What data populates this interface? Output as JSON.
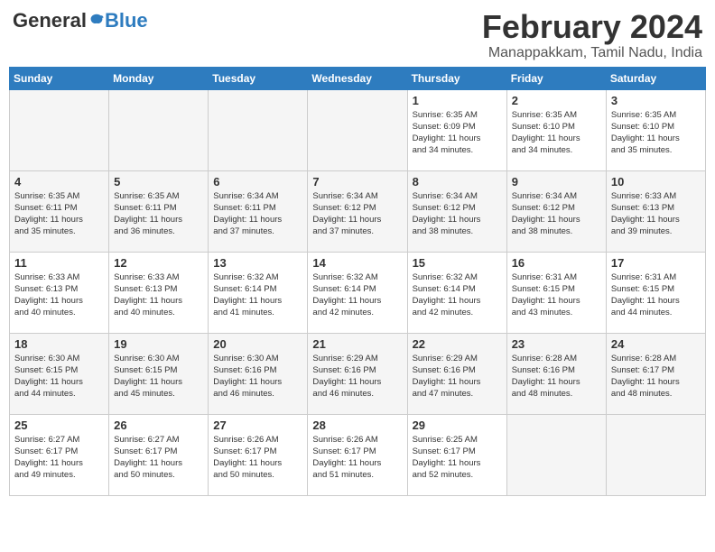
{
  "header": {
    "logo_general": "General",
    "logo_blue": "Blue",
    "title": "February 2024",
    "subtitle": "Manappakkam, Tamil Nadu, India"
  },
  "days_of_week": [
    "Sunday",
    "Monday",
    "Tuesday",
    "Wednesday",
    "Thursday",
    "Friday",
    "Saturday"
  ],
  "weeks": [
    [
      {
        "day": "",
        "info": ""
      },
      {
        "day": "",
        "info": ""
      },
      {
        "day": "",
        "info": ""
      },
      {
        "day": "",
        "info": ""
      },
      {
        "day": "1",
        "info": "Sunrise: 6:35 AM\nSunset: 6:09 PM\nDaylight: 11 hours\nand 34 minutes."
      },
      {
        "day": "2",
        "info": "Sunrise: 6:35 AM\nSunset: 6:10 PM\nDaylight: 11 hours\nand 34 minutes."
      },
      {
        "day": "3",
        "info": "Sunrise: 6:35 AM\nSunset: 6:10 PM\nDaylight: 11 hours\nand 35 minutes."
      }
    ],
    [
      {
        "day": "4",
        "info": "Sunrise: 6:35 AM\nSunset: 6:11 PM\nDaylight: 11 hours\nand 35 minutes."
      },
      {
        "day": "5",
        "info": "Sunrise: 6:35 AM\nSunset: 6:11 PM\nDaylight: 11 hours\nand 36 minutes."
      },
      {
        "day": "6",
        "info": "Sunrise: 6:34 AM\nSunset: 6:11 PM\nDaylight: 11 hours\nand 37 minutes."
      },
      {
        "day": "7",
        "info": "Sunrise: 6:34 AM\nSunset: 6:12 PM\nDaylight: 11 hours\nand 37 minutes."
      },
      {
        "day": "8",
        "info": "Sunrise: 6:34 AM\nSunset: 6:12 PM\nDaylight: 11 hours\nand 38 minutes."
      },
      {
        "day": "9",
        "info": "Sunrise: 6:34 AM\nSunset: 6:12 PM\nDaylight: 11 hours\nand 38 minutes."
      },
      {
        "day": "10",
        "info": "Sunrise: 6:33 AM\nSunset: 6:13 PM\nDaylight: 11 hours\nand 39 minutes."
      }
    ],
    [
      {
        "day": "11",
        "info": "Sunrise: 6:33 AM\nSunset: 6:13 PM\nDaylight: 11 hours\nand 40 minutes."
      },
      {
        "day": "12",
        "info": "Sunrise: 6:33 AM\nSunset: 6:13 PM\nDaylight: 11 hours\nand 40 minutes."
      },
      {
        "day": "13",
        "info": "Sunrise: 6:32 AM\nSunset: 6:14 PM\nDaylight: 11 hours\nand 41 minutes."
      },
      {
        "day": "14",
        "info": "Sunrise: 6:32 AM\nSunset: 6:14 PM\nDaylight: 11 hours\nand 42 minutes."
      },
      {
        "day": "15",
        "info": "Sunrise: 6:32 AM\nSunset: 6:14 PM\nDaylight: 11 hours\nand 42 minutes."
      },
      {
        "day": "16",
        "info": "Sunrise: 6:31 AM\nSunset: 6:15 PM\nDaylight: 11 hours\nand 43 minutes."
      },
      {
        "day": "17",
        "info": "Sunrise: 6:31 AM\nSunset: 6:15 PM\nDaylight: 11 hours\nand 44 minutes."
      }
    ],
    [
      {
        "day": "18",
        "info": "Sunrise: 6:30 AM\nSunset: 6:15 PM\nDaylight: 11 hours\nand 44 minutes."
      },
      {
        "day": "19",
        "info": "Sunrise: 6:30 AM\nSunset: 6:15 PM\nDaylight: 11 hours\nand 45 minutes."
      },
      {
        "day": "20",
        "info": "Sunrise: 6:30 AM\nSunset: 6:16 PM\nDaylight: 11 hours\nand 46 minutes."
      },
      {
        "day": "21",
        "info": "Sunrise: 6:29 AM\nSunset: 6:16 PM\nDaylight: 11 hours\nand 46 minutes."
      },
      {
        "day": "22",
        "info": "Sunrise: 6:29 AM\nSunset: 6:16 PM\nDaylight: 11 hours\nand 47 minutes."
      },
      {
        "day": "23",
        "info": "Sunrise: 6:28 AM\nSunset: 6:16 PM\nDaylight: 11 hours\nand 48 minutes."
      },
      {
        "day": "24",
        "info": "Sunrise: 6:28 AM\nSunset: 6:17 PM\nDaylight: 11 hours\nand 48 minutes."
      }
    ],
    [
      {
        "day": "25",
        "info": "Sunrise: 6:27 AM\nSunset: 6:17 PM\nDaylight: 11 hours\nand 49 minutes."
      },
      {
        "day": "26",
        "info": "Sunrise: 6:27 AM\nSunset: 6:17 PM\nDaylight: 11 hours\nand 50 minutes."
      },
      {
        "day": "27",
        "info": "Sunrise: 6:26 AM\nSunset: 6:17 PM\nDaylight: 11 hours\nand 50 minutes."
      },
      {
        "day": "28",
        "info": "Sunrise: 6:26 AM\nSunset: 6:17 PM\nDaylight: 11 hours\nand 51 minutes."
      },
      {
        "day": "29",
        "info": "Sunrise: 6:25 AM\nSunset: 6:17 PM\nDaylight: 11 hours\nand 52 minutes."
      },
      {
        "day": "",
        "info": ""
      },
      {
        "day": "",
        "info": ""
      }
    ]
  ]
}
